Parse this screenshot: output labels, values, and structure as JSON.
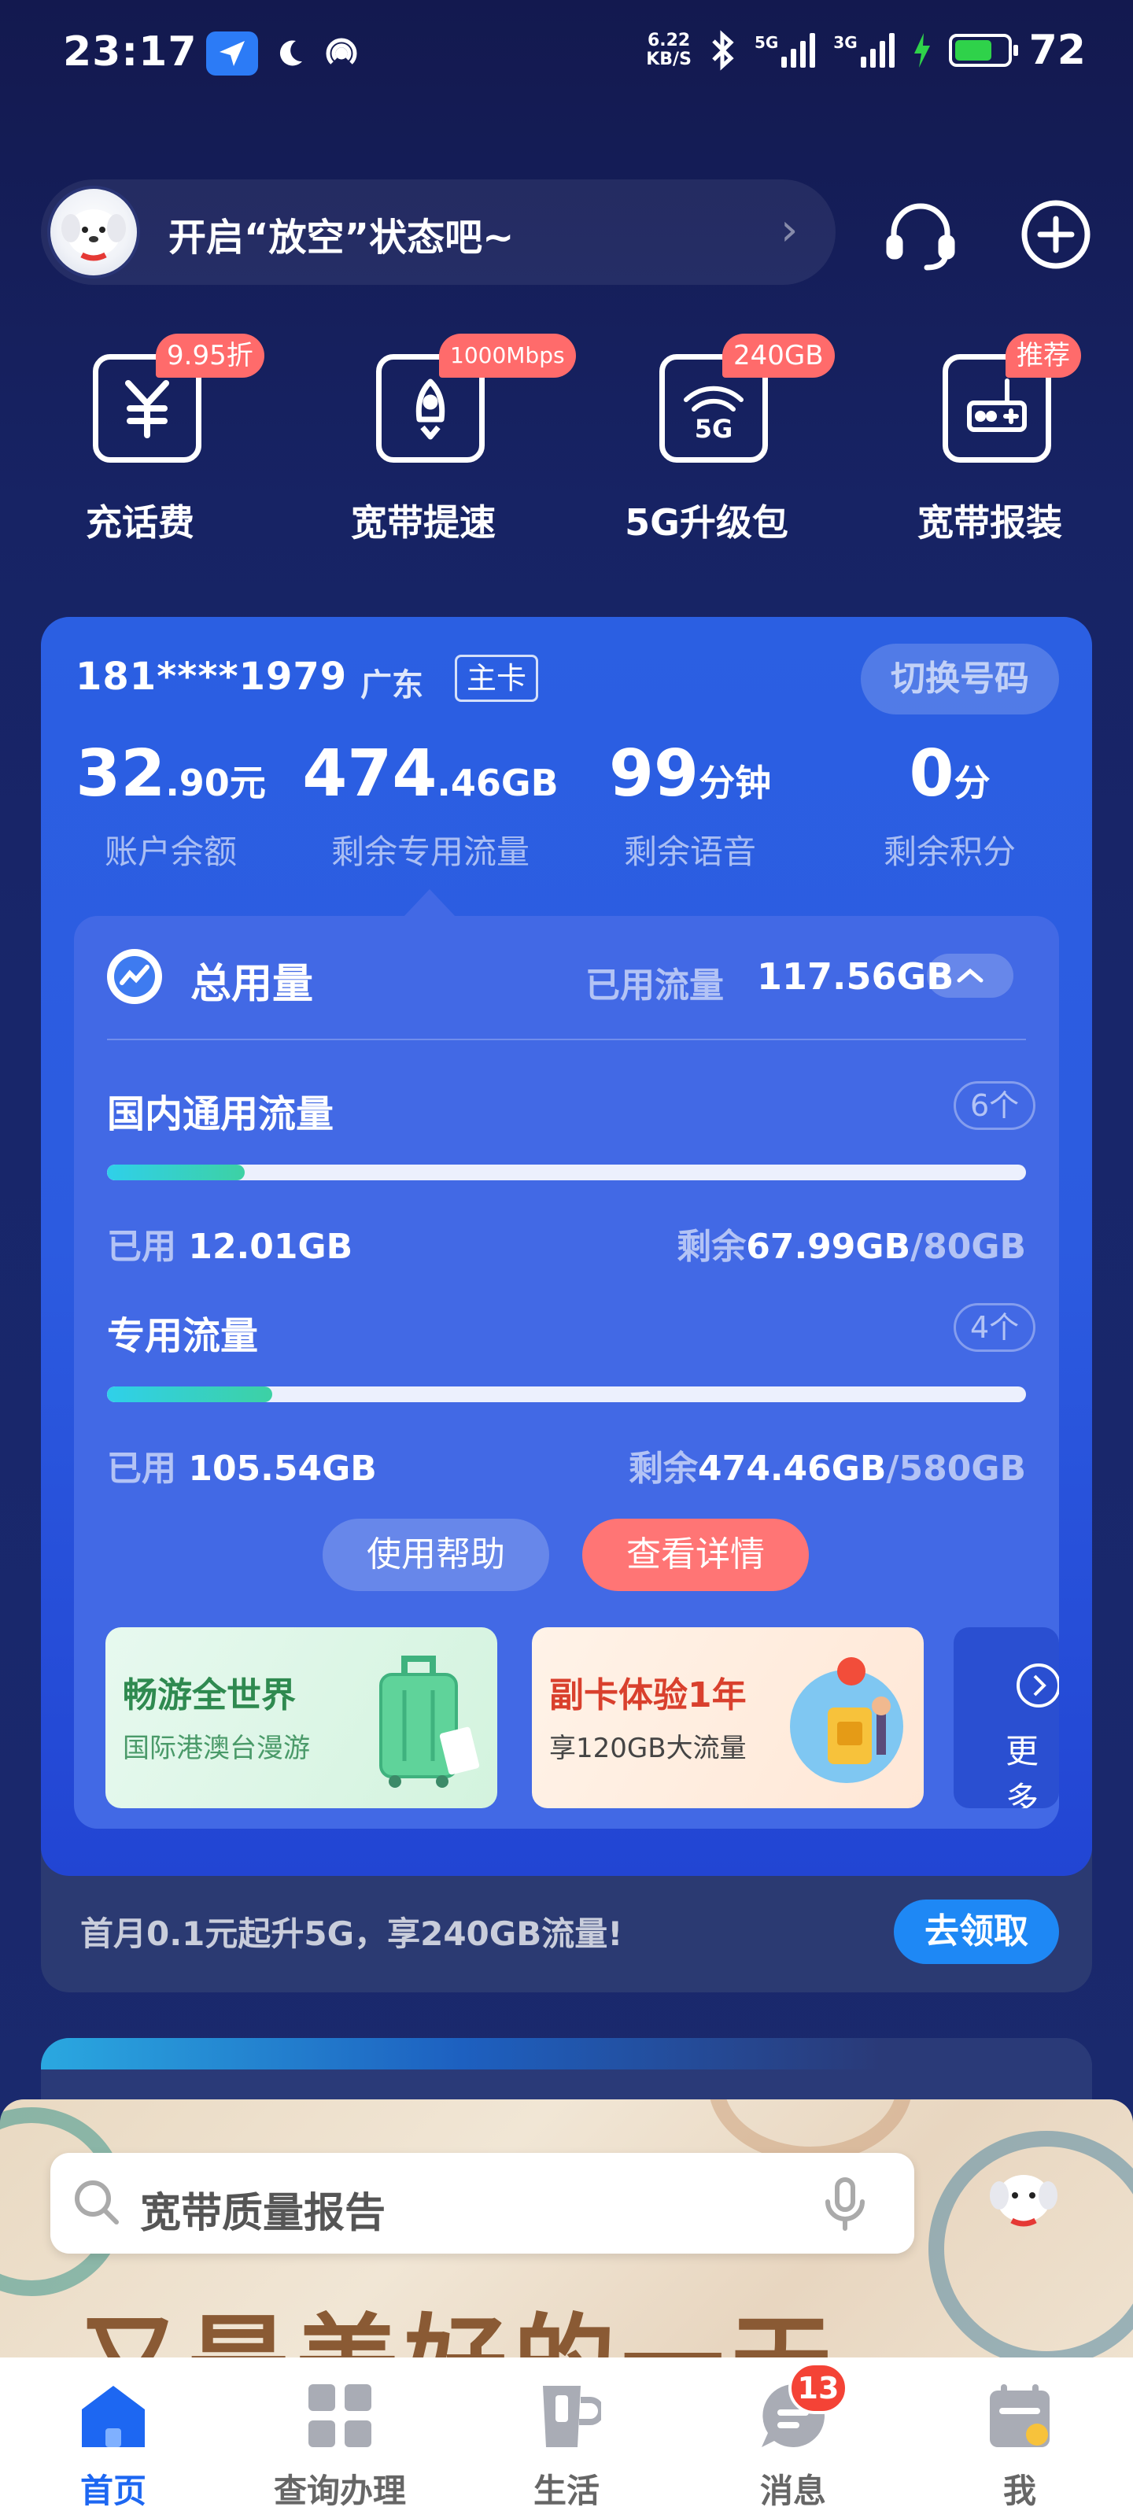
{
  "status_bar": {
    "time": "23:17",
    "net_speed_value": "6.22",
    "net_speed_unit": "KB/S",
    "signal1_label": "5G",
    "signal2_label": "3G",
    "battery": "72",
    "battery_level": 0.72,
    "icons": [
      "navigation-icon",
      "moon-icon",
      "hotspot-icon",
      "bluetooth-icon",
      "signal-icon",
      "charging-icon",
      "battery-icon"
    ]
  },
  "header": {
    "text": "开启“放空”状态吧~"
  },
  "quick_actions": [
    {
      "label": "充话费",
      "badge": "9.95折",
      "icon": "yuan-icon"
    },
    {
      "label": "宽带提速",
      "badge": "1000Mbps",
      "icon": "rocket-icon"
    },
    {
      "label": "5G升级包",
      "badge": "240GB",
      "icon": "wifi-5g-icon"
    },
    {
      "label": "宽带报装",
      "badge": "推荐",
      "icon": "router-icon"
    }
  ],
  "account": {
    "phone": "181****1979",
    "province": "广东",
    "card_tag": "主卡",
    "switch_label": "切换号码",
    "stats": [
      {
        "value": "32",
        "decimal": ".90",
        "unit": "元",
        "label": "账户余额"
      },
      {
        "value": "474",
        "decimal": ".46",
        "unit": "GB",
        "label": "剩余专用流量"
      },
      {
        "value": "99",
        "decimal": "",
        "unit": "分钟",
        "label": "剩余语音"
      },
      {
        "value": "0",
        "decimal": "",
        "unit": "分",
        "label": "剩余积分"
      }
    ]
  },
  "usage": {
    "title": "总用量",
    "used_label": "已用流量",
    "used_value": "117.56GB",
    "sections": [
      {
        "title": "国内通用流量",
        "count": "6个",
        "used_label": "已用",
        "used": "12.01GB",
        "remain_label": "剩余",
        "remain": "67.99GB",
        "total": "/80GB",
        "fraction": 0.15
      },
      {
        "title": "专用流量",
        "count": "4个",
        "used_label": "已用",
        "used": "105.54GB",
        "remain_label": "剩余",
        "remain": "474.46GB",
        "total": "/580GB",
        "fraction": 0.18
      }
    ],
    "help_label": "使用帮助",
    "detail_label": "查看详情"
  },
  "promos": [
    {
      "title": "畅游全世界",
      "subtitle": "国际港澳台漫游",
      "color": "#2f8a50",
      "subcolor": "#4a9a69"
    },
    {
      "title": "副卡体验1年",
      "subtitle": "享120GB大流量",
      "color": "#d9402d",
      "subcolor": "#444444"
    },
    {
      "more": "更多"
    }
  ],
  "offer": {
    "text": "首月0.1元起升5G，享240GB流量!",
    "button": "去领取"
  },
  "banner": {
    "slogan": "又是美好的一天"
  },
  "search": {
    "text": "宽带质量报告"
  },
  "bottom_nav": [
    {
      "label": "首页",
      "active": true
    },
    {
      "label": "查询办理",
      "active": false
    },
    {
      "label": "生活",
      "active": false
    },
    {
      "label": "消息",
      "active": false,
      "badge": "13"
    },
    {
      "label": "我",
      "active": false
    }
  ],
  "colors": {
    "accent": "#1d67f2",
    "card": "#2c5be0",
    "badge": "#ff6b6b",
    "detail_button": "#ff7575",
    "progress": "#2fd0ea"
  }
}
